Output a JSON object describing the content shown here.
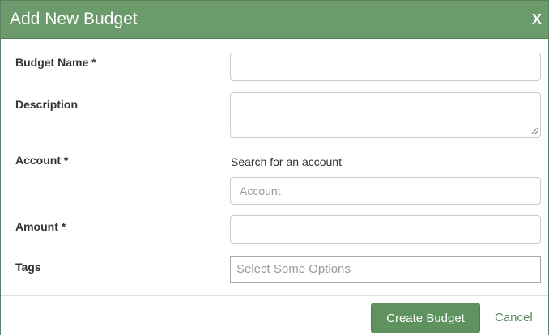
{
  "dialog": {
    "title": "Add New Budget",
    "close_label": "X"
  },
  "form": {
    "budget_name": {
      "label": "Budget Name *",
      "value": ""
    },
    "description": {
      "label": "Description",
      "value": ""
    },
    "account": {
      "label": "Account *",
      "hint": "Search for an account",
      "placeholder": "Account",
      "value": ""
    },
    "amount": {
      "label": "Amount *",
      "value": ""
    },
    "tags": {
      "label": "Tags",
      "placeholder": "Select Some Options"
    }
  },
  "footer": {
    "create_label": "Create Budget",
    "cancel_label": "Cancel"
  },
  "colors": {
    "titlebar": "#6b9a6b",
    "primary_button": "#5e9360",
    "link": "#5a8a5c"
  },
  "icons": {
    "close": "close-icon",
    "textarea_resize": "resize-grip-icon"
  }
}
